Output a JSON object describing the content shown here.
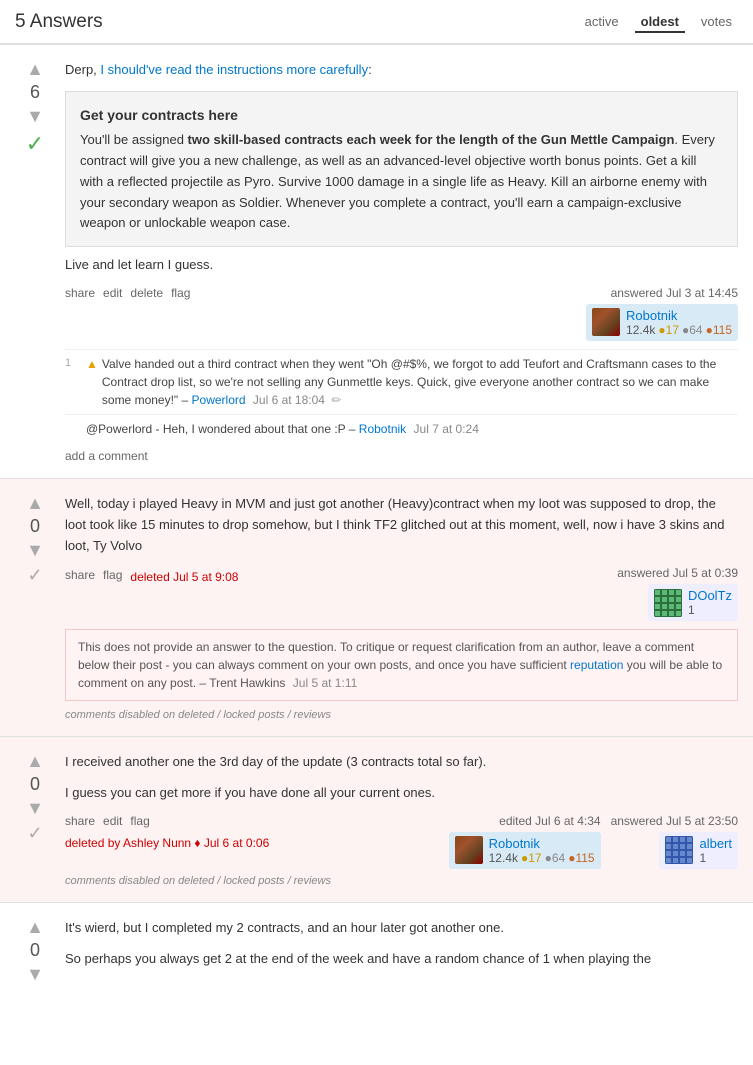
{
  "header": {
    "title": "5 Answers",
    "sort_tabs": [
      {
        "label": "active",
        "id": "active",
        "active": false
      },
      {
        "label": "oldest",
        "id": "oldest",
        "active": true
      },
      {
        "label": "votes",
        "id": "votes",
        "active": false
      }
    ]
  },
  "answers": [
    {
      "id": "answer-1",
      "votes": 6,
      "accepted": true,
      "deleted": false,
      "text_intro": "Derp, I should've read the instructions more carefully:",
      "info_box": {
        "title": "Get your contracts here",
        "body": "You'll be assigned two skill-based contracts each week for the length of the Gun Mettle Campaign. Every contract will give you a new challenge, as well as an advanced-level objective worth bonus points. Get a kill with a reflected projectile as Pyro. Survive 1000 damage in a single life as Heavy. Kill an airborne enemy with your secondary weapon as Soldier. Whenever you complete a contract, you'll earn a campaign-exclusive weapon or unlockable weapon case."
      },
      "text_outro": "Live and let learn I guess.",
      "actions": [
        "share",
        "edit",
        "delete",
        "flag"
      ],
      "answered": "answered Jul 3 at 14:45",
      "user": {
        "name": "Robotnik",
        "avatar_type": "robotnik",
        "rep": "12.4k",
        "gold": 17,
        "silver": 64,
        "bronze": 115
      },
      "comments": [
        {
          "vote": "1",
          "warning": true,
          "text": "Valve handed out a third contract when they went \"Oh @#$%, we forgot to add Teufort and Craftsmann cases to the Contract drop list, so we're not selling any Gunmettle keys. Quick, give everyone another contract so we can make some money!\"",
          "author": "Powerlord",
          "date": "Jul 6 at 18:04",
          "editable": true
        },
        {
          "vote": "",
          "warning": false,
          "text": "@Powerlord - Heh, I wondered about that one :P –",
          "author": "Robotnik",
          "date": "Jul 7 at 0:24",
          "editable": false
        }
      ],
      "add_comment": "add a comment"
    },
    {
      "id": "answer-2",
      "votes": 0,
      "accepted": false,
      "deleted": true,
      "deleted_label": "deleted Jul 5 at 9:08",
      "text": "Well, today i played Heavy in MVM and just got another (Heavy)contract when my loot was supposed to drop, the loot took like 15 minutes to drop somehow, but I think TF2 glitched out at this moment, well, now i have 3 skins and loot, Ty Volvo",
      "actions": [
        "share",
        "flag"
      ],
      "answered": "answered Jul 5 at 0:39",
      "user": {
        "name": "DOolTz",
        "avatar_type": "doolt",
        "rep": "1",
        "gold": null,
        "silver": null,
        "bronze": null
      },
      "deleted_notice": {
        "body": "This does not provide an answer to the question. To critique or request clarification from an author, leave a comment below their post - you can always comment on your own posts, and once you have sufficient",
        "link_text": "reputation",
        "body2": "you will be able to comment on any post. –",
        "author": "Trent Hawkins",
        "date": "Jul 5 at 1:11"
      },
      "comments_disabled": "comments disabled on deleted / locked posts / reviews"
    },
    {
      "id": "answer-3",
      "votes": 0,
      "accepted": false,
      "deleted": true,
      "text_lines": [
        "I received another one the 3rd day of the update (3 contracts total so far).",
        "I guess you can get more if you have done all your current ones."
      ],
      "actions": [
        "share",
        "edit",
        "flag"
      ],
      "deleted_by": "deleted by Ashley Nunn ♦ Jul 6 at 0:06",
      "edited": "edited Jul 6 at 4:34",
      "answered": "answered Jul 5 at 23:50",
      "user_editor": {
        "name": "Robotnik",
        "avatar_type": "robotnik",
        "rep": "12.4k",
        "gold": 17,
        "silver": 64,
        "bronze": 115
      },
      "user_answerer": {
        "name": "albert",
        "avatar_type": "albert",
        "rep": "1",
        "gold": null,
        "silver": null,
        "bronze": null
      },
      "comments_disabled": "comments disabled on deleted / locked posts / reviews"
    },
    {
      "id": "answer-4",
      "votes": 0,
      "accepted": false,
      "deleted": false,
      "text_lines": [
        "It's wierd, but I completed my 2 contracts, and an hour later got another one.",
        "So perhaps you always get 2 at the end of the week and have a random chance of 1 when playing the"
      ]
    }
  ]
}
